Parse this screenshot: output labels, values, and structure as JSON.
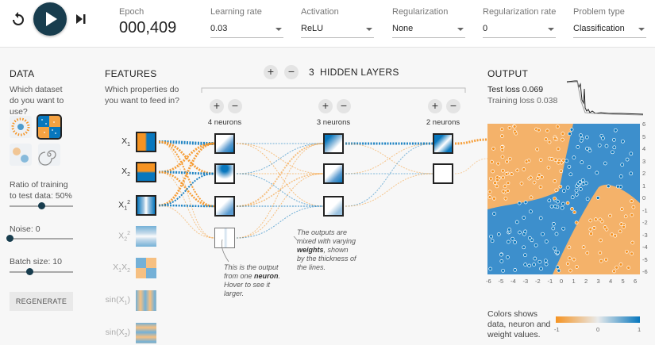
{
  "controls": {
    "epoch_label": "Epoch",
    "epoch_value": "000,409",
    "learning_rate": {
      "label": "Learning rate",
      "value": "0.03"
    },
    "activation": {
      "label": "Activation",
      "value": "ReLU"
    },
    "regularization": {
      "label": "Regularization",
      "value": "None"
    },
    "regularization_rate": {
      "label": "Regularization rate",
      "value": "0"
    },
    "problem_type": {
      "label": "Problem type",
      "value": "Classification"
    }
  },
  "data_panel": {
    "title": "DATA",
    "question": "Which dataset do you want to use?",
    "datasets": [
      "circle-dataset",
      "xor-dataset",
      "gaussian-dataset",
      "spiral-dataset"
    ],
    "selected_dataset": "xor-dataset",
    "ratio": {
      "label": "Ratio of training to test data:",
      "value": "50%",
      "fraction": 0.5
    },
    "noise": {
      "label": "Noise:",
      "value": "0",
      "fraction": 0.0
    },
    "batch": {
      "label": "Batch size:",
      "value": "10",
      "fraction": 0.31
    },
    "regenerate_label": "REGENERATE"
  },
  "features_panel": {
    "title": "FEATURES",
    "question": "Which properties do you want to feed in?",
    "features": [
      {
        "base": "X",
        "sub": "1",
        "sup": "",
        "active": true
      },
      {
        "base": "X",
        "sub": "2",
        "sup": "",
        "active": true
      },
      {
        "base": "X",
        "sub": "1",
        "sup": "2",
        "active": true
      },
      {
        "base": "X",
        "sub": "2",
        "sup": "2",
        "active": false
      },
      {
        "base": "X",
        "sub": "1",
        "mid": "X",
        "sub2": "2",
        "sup": "",
        "active": false
      },
      {
        "base": "sin(X",
        "sub": "1",
        "tail": ")",
        "sup": "",
        "active": false
      },
      {
        "base": "sin(X",
        "sub": "2",
        "tail": ")",
        "sup": "",
        "active": false
      }
    ]
  },
  "network": {
    "hidden_layer_count": "3",
    "hidden_layers_label": "HIDDEN LAYERS",
    "layers": [
      {
        "neurons_label": "4 neurons",
        "count": 4
      },
      {
        "neurons_label": "3 neurons",
        "count": 3
      },
      {
        "neurons_label": "2 neurons",
        "count": 2
      }
    ],
    "plus": "+",
    "minus": "−",
    "annotation_neuron": [
      "This is the output",
      "from one ",
      "neuron",
      ".",
      "Hover to see it",
      "larger."
    ],
    "annotation_weights": [
      "The outputs are",
      "mixed with varying",
      "weights",
      ", shown",
      "by the thickness of",
      "the lines."
    ]
  },
  "output_panel": {
    "title": "OUTPUT",
    "test_loss": "Test loss 0.069",
    "train_loss": "Training loss 0.038",
    "axis_ticks": [
      "-6",
      "-5",
      "-4",
      "-3",
      "-2",
      "-1",
      "0",
      "1",
      "2",
      "3",
      "4",
      "5",
      "6"
    ],
    "y_ticks": [
      "6",
      "5",
      "4",
      "3",
      "2",
      "1",
      "0",
      "-1",
      "-2",
      "-3",
      "-4",
      "-5",
      "-6"
    ],
    "colors_note": "Colors shows data, neuron and weight values.",
    "colorbar_ticks": [
      "-1",
      "0",
      "1"
    ]
  },
  "colors": {
    "orange": "#f59322",
    "blue": "#0877bd",
    "dark": "#183d4e"
  }
}
